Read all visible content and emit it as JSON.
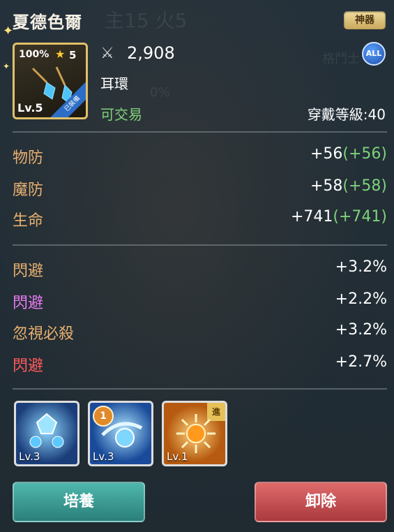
{
  "item": {
    "name": "夏德色爾",
    "grade_badge": "神器",
    "all_badge": "ALL",
    "icon_percent": "100%",
    "icon_stars": "5",
    "icon_level": "Lv.5",
    "icon_equipped": "已裝備",
    "power": "2,908",
    "type": "耳環",
    "tradable": "可交易",
    "wear_level": "穿戴等級:40"
  },
  "background_text": {
    "top_label": "主15 火5",
    "side_label": "格鬥士",
    "percent": "0%"
  },
  "base_stats": [
    {
      "name": "物防",
      "value": "+56",
      "bonus": "(+56)"
    },
    {
      "name": "魔防",
      "value": "+58",
      "bonus": "(+58)"
    },
    {
      "name": "生命",
      "value": "+741",
      "bonus": "(+741)"
    }
  ],
  "extra_stats": [
    {
      "name": "閃避",
      "value": "+3.2%",
      "color": "#e8b070"
    },
    {
      "name": "閃避",
      "value": "+2.2%",
      "color": "#e67cf0"
    },
    {
      "name": "忽視必殺",
      "value": "+3.2%",
      "color": "#e8b070"
    },
    {
      "name": "閃避",
      "value": "+2.7%",
      "color": "#ff5a5a"
    }
  ],
  "skills": [
    {
      "level": "Lv.3",
      "icon": "crystal-icon",
      "badge": ""
    },
    {
      "level": "Lv.3",
      "icon": "blue-comet-icon",
      "badge": "1"
    },
    {
      "level": "Lv.1",
      "icon": "sun-burst-icon",
      "badge": "進"
    }
  ],
  "buttons": {
    "train": "培養",
    "remove": "卸除"
  },
  "colors": {
    "stat_name": "#e8b070",
    "bonus": "#7ed27a",
    "gold": "#e1c06a"
  }
}
